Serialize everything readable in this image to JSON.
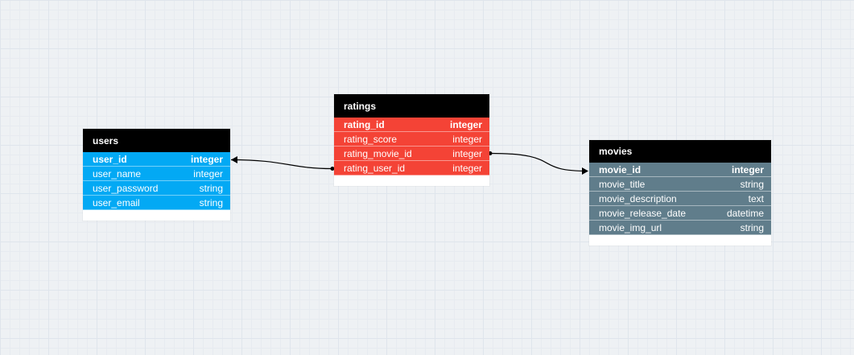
{
  "canvas": {
    "background_color": "#eef1f4",
    "grid_color": "#dfe5ec"
  },
  "tables": {
    "users": {
      "title": "users",
      "color": "#03a9f4",
      "columns": [
        {
          "name": "user_id",
          "type": "integer",
          "primary_key": true
        },
        {
          "name": "user_name",
          "type": "integer"
        },
        {
          "name": "user_password",
          "type": "string"
        },
        {
          "name": "user_email",
          "type": "string"
        }
      ]
    },
    "ratings": {
      "title": "ratings",
      "color": "#f44336",
      "columns": [
        {
          "name": "rating_id",
          "type": "integer",
          "primary_key": true
        },
        {
          "name": "rating_score",
          "type": "integer"
        },
        {
          "name": "rating_movie_id",
          "type": "integer"
        },
        {
          "name": "rating_user_id",
          "type": "integer"
        }
      ]
    },
    "movies": {
      "title": "movies",
      "color": "#607d8b",
      "columns": [
        {
          "name": "movie_id",
          "type": "integer",
          "primary_key": true
        },
        {
          "name": "movie_title",
          "type": "string"
        },
        {
          "name": "movie_description",
          "type": "text"
        },
        {
          "name": "movie_release_date",
          "type": "datetime"
        },
        {
          "name": "movie_img_url",
          "type": "string"
        }
      ]
    }
  },
  "relations": [
    {
      "from": "ratings.rating_user_id",
      "to": "users.user_id"
    },
    {
      "from": "ratings.rating_movie_id",
      "to": "movies.movie_id"
    }
  ]
}
